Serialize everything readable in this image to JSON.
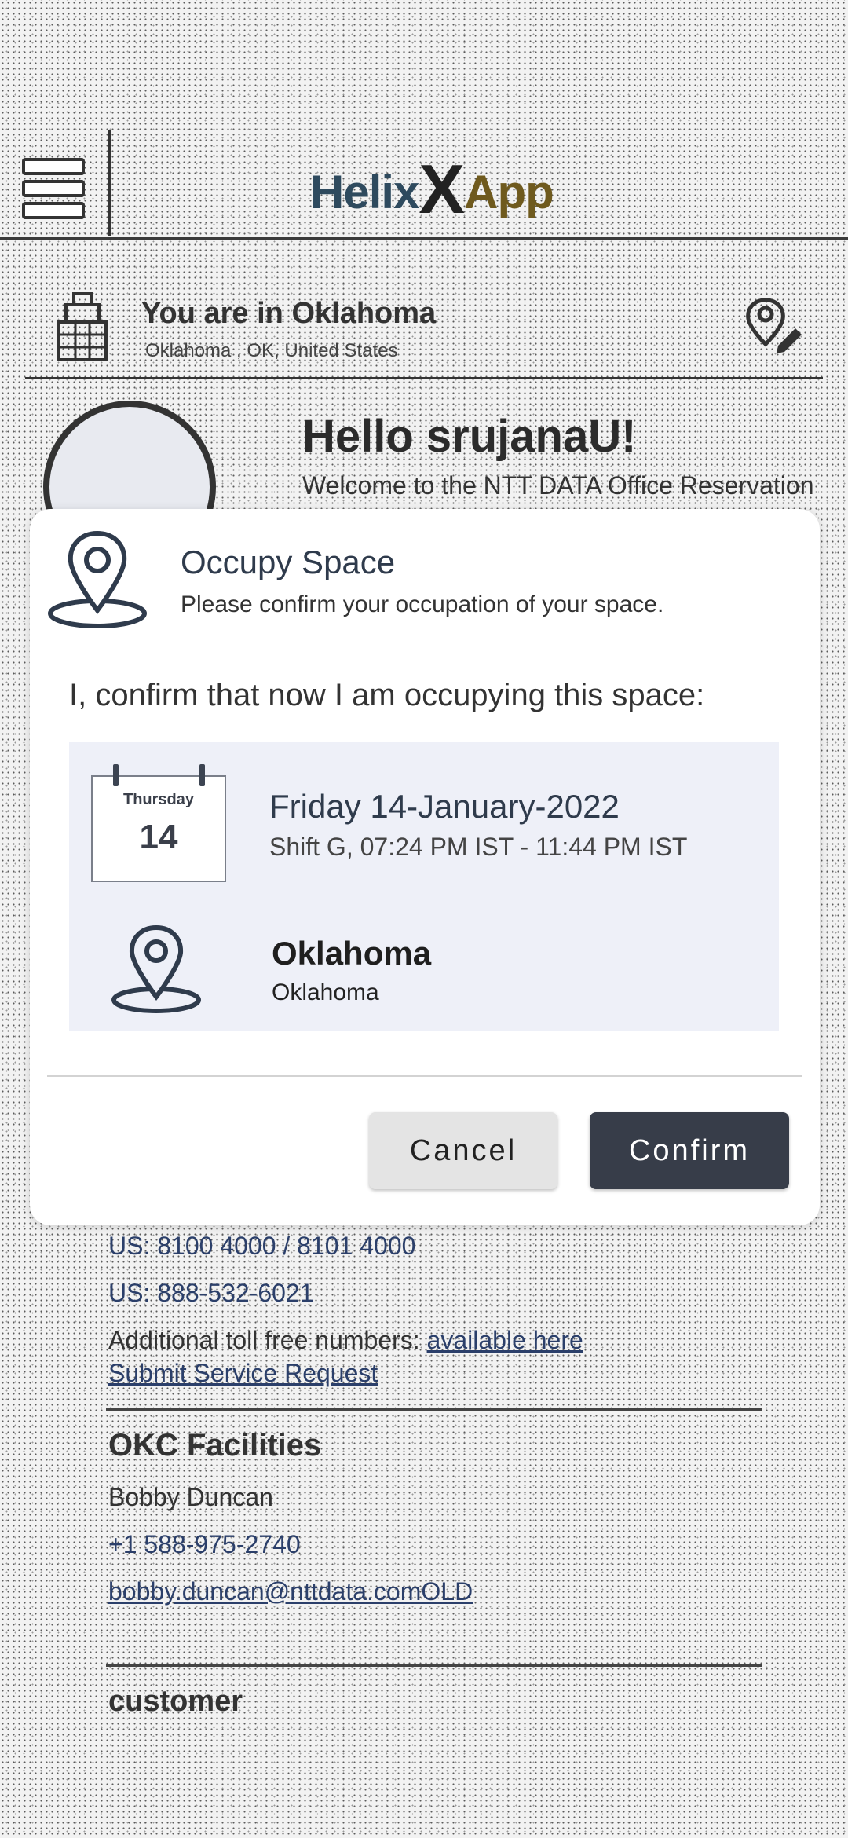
{
  "app": {
    "title_part1": "Helix",
    "title_x": "X",
    "title_part2": "App"
  },
  "location": {
    "title": "You are in Oklahoma",
    "subtitle": "Oklahoma , OK, United States"
  },
  "greeting": {
    "hello": "Hello srujanaU!",
    "welcome": "Welcome to the NTT DATA Office Reservation"
  },
  "dialog": {
    "title": "Occupy Space",
    "subtitle": "Please confirm your occupation of your space.",
    "confirm_text": "I, confirm that now I am occupying this space:",
    "calendar": {
      "day_name": "Thursday",
      "day_number": "14"
    },
    "date": "Friday 14-January-2022",
    "shift": "Shift G, 07:24 PM IST - 11:44 PM IST",
    "place_title": "Oklahoma",
    "place_subtitle": "Oklahoma",
    "cancel_label": "Cancel",
    "confirm_label": "Confirm"
  },
  "contacts": {
    "phone1": "US: 8100 4000 / 8101 4000",
    "phone2": "US: 888-532-6021",
    "tollfree_text": "Additional toll free numbers: ",
    "tollfree_link": "available here",
    "service_request": "Submit Service Request",
    "facilities_title": "OKC Facilities",
    "facilities_name": "Bobby Duncan",
    "facilities_phone": "+1 588-975-2740",
    "facilities_email": "bobby.duncan@nttdata.comOLD",
    "customer": "customer"
  },
  "colors": {
    "confirm_button": "#373d49",
    "cancel_button": "#e4e4e4",
    "card_background": "#eef0f8",
    "link": "#2b3f6a"
  }
}
